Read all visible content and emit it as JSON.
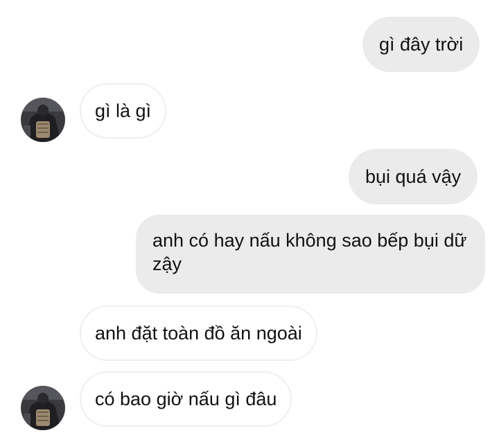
{
  "messages": [
    {
      "direction": "outgoing",
      "text": "gì đây trời"
    },
    {
      "direction": "incoming",
      "text": "gì là gì",
      "has_avatar": true
    },
    {
      "direction": "outgoing",
      "text": "bụi quá vậy"
    },
    {
      "direction": "outgoing",
      "text": "anh có hay nấu không sao bếp bụi dữ zậy"
    },
    {
      "direction": "incoming",
      "text": "anh đặt toàn đồ ăn ngoài"
    },
    {
      "direction": "incoming",
      "text": "có bao giờ nấu gì đâu",
      "has_avatar": true
    }
  ],
  "colors": {
    "outgoing_bubble": "#ebebeb",
    "incoming_bubble": "#ffffff",
    "incoming_border": "#eeeeee",
    "text": "#111111"
  },
  "icons": {
    "contact_avatar": "avatar-icon"
  }
}
